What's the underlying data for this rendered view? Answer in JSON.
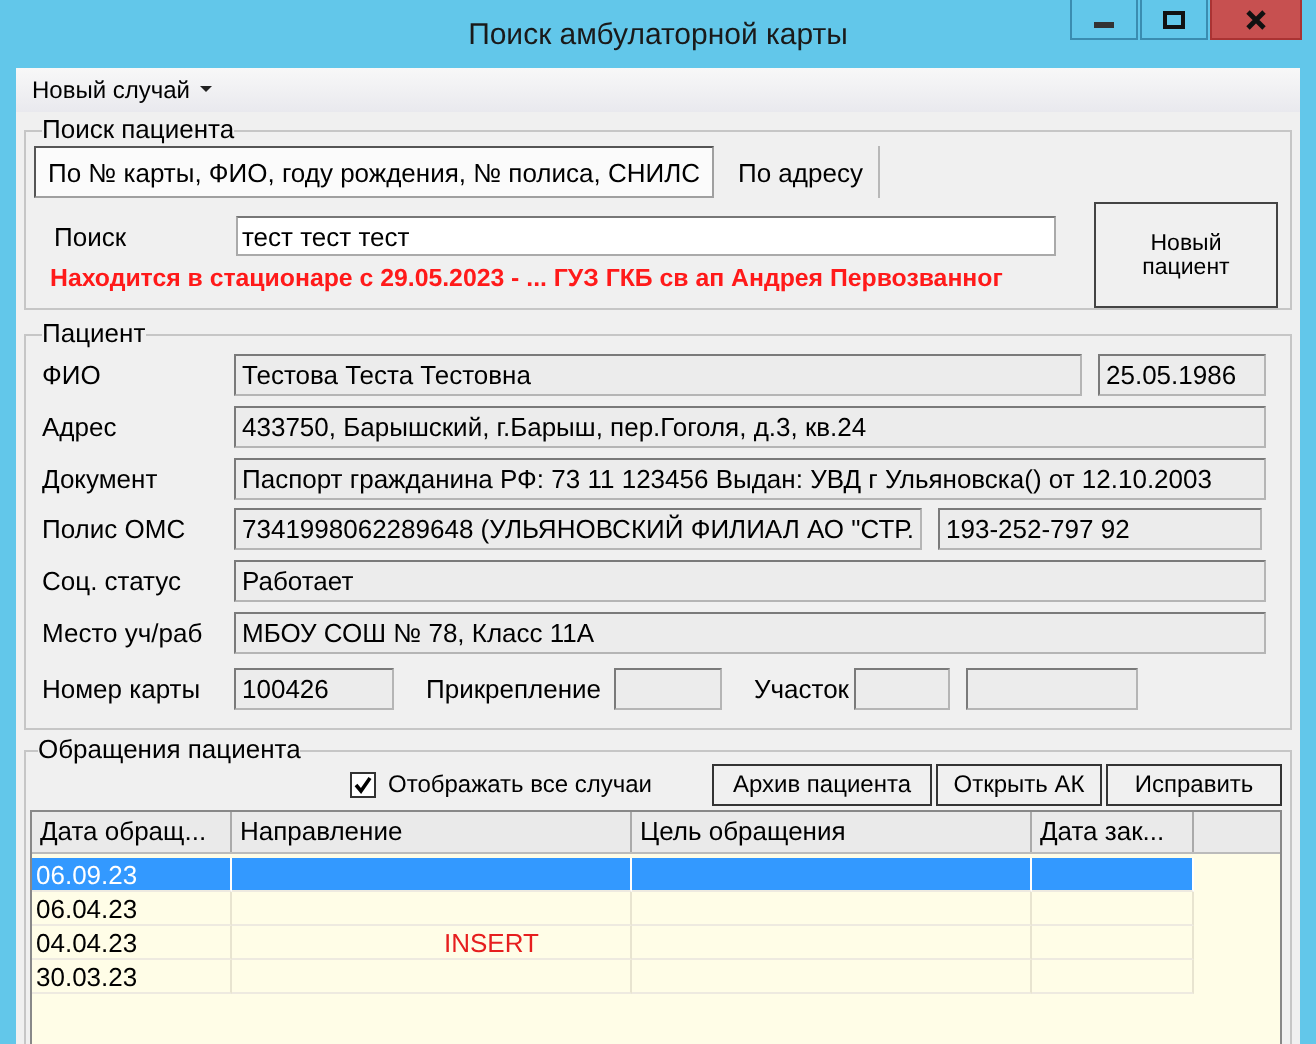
{
  "window": {
    "title": "Поиск амбулаторной карты"
  },
  "menu": [
    {
      "label": "Новый случай",
      "dropdown": true
    }
  ],
  "search_group": {
    "title": "Поиск пациента",
    "tabs": [
      {
        "label": "По № карты, ФИО, году рождения, № полиса, СНИЛС",
        "selected": true
      },
      {
        "label": "По адресу",
        "selected": false
      }
    ],
    "search_label": "Поиск",
    "search_value": "тест тест тест",
    "alert": "Находится в стационаре с 29.05.2023 - ... ГУЗ ГКБ св ап Андрея Первозванног",
    "new_patient_button": "Новый пациент"
  },
  "patient_group": {
    "title": "Пациент",
    "fio_label": "ФИО",
    "fio": "Тестова Теста Тестовна",
    "birth_date": "25.05.1986",
    "address_label": "Адрес",
    "address": "433750, Барышский, г.Барыш, пер.Гоголя, д.3, кв.24",
    "document_label": "Документ",
    "document": "Паспорт гражданина РФ: 73 11 123456 Выдан: УВД г Ульяновска() от 12.10.2003",
    "policy_label": "Полис ОМС",
    "policy": "7341998062289648 (УЛЬЯНОВСКИЙ ФИЛИАЛ АО \"СТР.",
    "snils": "193-252-797 92",
    "social_label": "Соц. статус",
    "social": "Работает",
    "work_label": "Место уч/раб",
    "work": "МБОУ СОШ № 78, Класс 11А",
    "card_label": "Номер карты",
    "card_number": "100426",
    "attachment_label": "Прикрепление",
    "district_label": "Участок"
  },
  "cases_group": {
    "title": "Обращения пациента",
    "show_all": {
      "label": "Отображать все случаи",
      "checked": true
    },
    "buttons": [
      "Архив пациента",
      "Открыть АК",
      "Исправить"
    ],
    "table": {
      "columns": [
        "Дата обращ...",
        "Направление",
        "Цель обращения",
        "Дата зак..."
      ],
      "rows": [
        {
          "date": "06.09.23",
          "selected": true
        },
        {
          "date": "06.04.23",
          "selected": false
        },
        {
          "date": "04.04.23",
          "selected": false
        },
        {
          "date": "30.03.23",
          "selected": false
        }
      ],
      "overlay": "INSERT"
    }
  }
}
